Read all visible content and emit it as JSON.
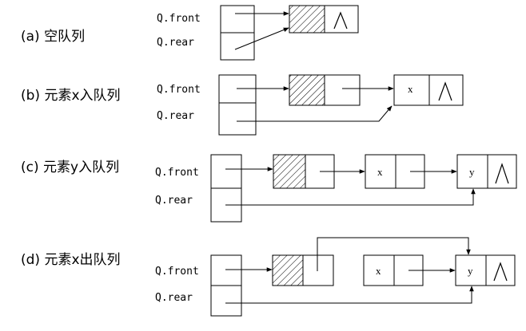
{
  "panels": [
    {
      "caption": "(a) 空队列",
      "front_label": "Q.front",
      "rear_label": "Q.rear"
    },
    {
      "caption": "(b) 元素x入队列",
      "front_label": "Q.front",
      "rear_label": "Q.rear",
      "nodes": [
        "x"
      ]
    },
    {
      "caption": "(c) 元素y入队列",
      "front_label": "Q.front",
      "rear_label": "Q.rear",
      "nodes": [
        "x",
        "y"
      ]
    },
    {
      "caption": "(d) 元素x出队列",
      "front_label": "Q.front",
      "rear_label": "Q.rear",
      "nodes": [
        "x",
        "y"
      ]
    }
  ],
  "null_symbol": "/\\"
}
